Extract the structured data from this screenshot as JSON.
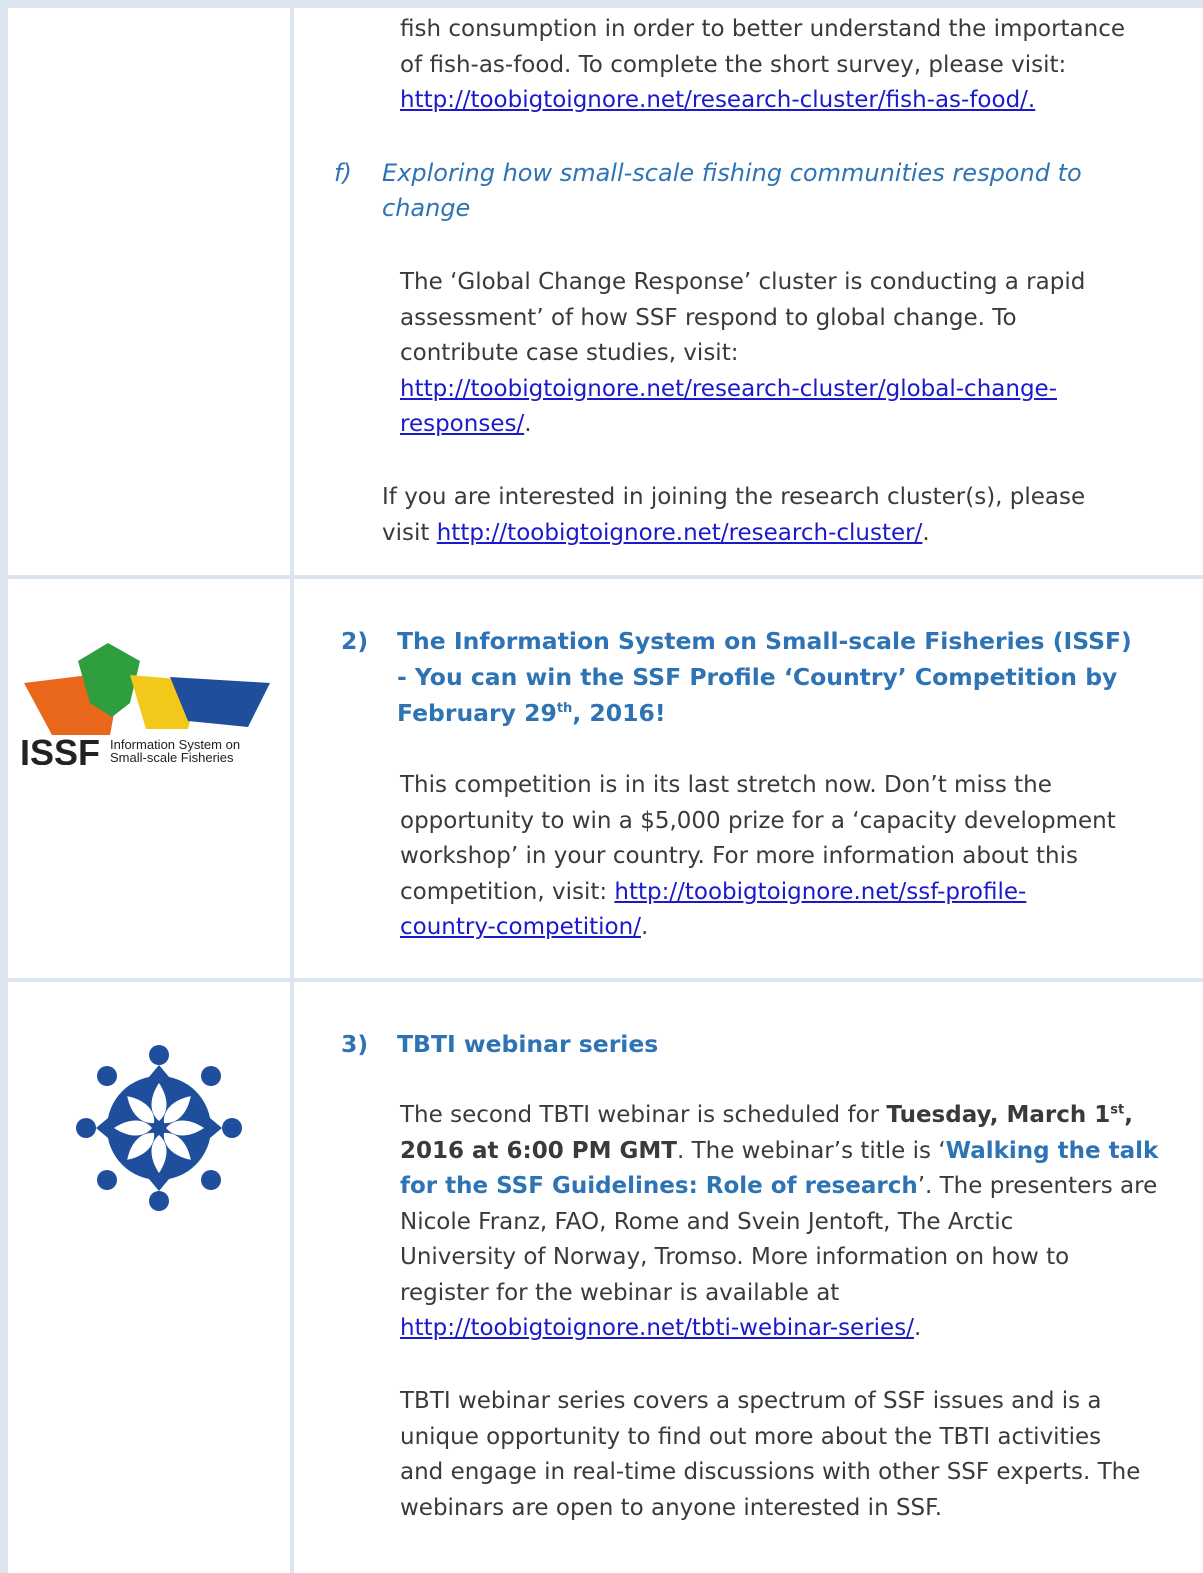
{
  "section1": {
    "intro_lines": [
      "fish consumption in order to better understand the importance",
      "of fish-as-food. To complete the short survey, please visit:"
    ],
    "intro_link": "http://toobigtoignore.net/research-cluster/fish-as-food/.",
    "sub_f": {
      "label": "f)",
      "title_lines": [
        "Exploring how small-scale fishing communities respond to",
        "change"
      ],
      "body_lines": [
        "The ‘Global Change Response’ cluster is conducting a rapid",
        "assessment’ of how SSF respond to global change. To",
        "contribute case studies, visit:"
      ],
      "link_lines": [
        "http://toobigtoignore.net/research-cluster/global-change-",
        "responses/"
      ],
      "link_tail": "."
    },
    "join_line1": "If you are interested in joining the research cluster(s), please",
    "join_prefix": "visit ",
    "join_link": "http://toobigtoignore.net/research-cluster/",
    "join_tail": "."
  },
  "section2": {
    "number": "2)",
    "title_line1": "The Information System on Small-scale Fisheries (ISSF)",
    "title_line2": "- You can win the SSF Profile ‘Country’ Competition by",
    "title_line3_pre": "February 29",
    "title_line3_sup": "th",
    "title_line3_post": ", 2016!",
    "body_lines": [
      "This competition is in its last stretch now. Don’t miss the",
      "opportunity to win a $5,000 prize for a ‘capacity development",
      "workshop’ in your country. For more information about this"
    ],
    "body_line4_pre": "competition, visit: ",
    "link_part1": "http://toobigtoignore.net/ssf-profile-",
    "link_part2": "country-competition/",
    "link_tail": ".",
    "logo": {
      "name": "issf-logo",
      "acronym": "ISSF",
      "tagline_line1": "Information System on",
      "tagline_line2": "Small-scale Fisheries",
      "colors": [
        "#e8671b",
        "#2e9e3e",
        "#f2c81a",
        "#1f4e9c"
      ]
    }
  },
  "section3": {
    "number": "3)",
    "title": "TBTI webinar series",
    "p1": {
      "l1_pre": "The second TBTI webinar is scheduled for ",
      "l1_bold": "Tuesday, March 1",
      "l1_sup": "st",
      "l1_bold_tail": ",",
      "l2_bold": "2016 at 6:00 PM GMT",
      "l2_mid": ". The webinar’s title is ‘",
      "l2_blue": "Walking the talk",
      "l3_blue": "for the SSF Guidelines: Role of research",
      "l3_tail": "’. The presenters are",
      "lines": [
        "Nicole Franz, FAO, Rome and Svein Jentoft, The Arctic",
        "University of Norway, Tromso. More information on how to",
        "register for the webinar is available at"
      ],
      "link": "http://toobigtoignore.net/tbti-webinar-series/",
      "link_tail": "."
    },
    "p2_lines": [
      "TBTI webinar series covers a spectrum of SSF issues and is a",
      "unique opportunity to find out more about the TBTI activities",
      "and engage in real-time discussions with other SSF experts. The",
      "webinars are open to anyone interested in SSF."
    ],
    "logo_color": "#1f4e9c"
  }
}
